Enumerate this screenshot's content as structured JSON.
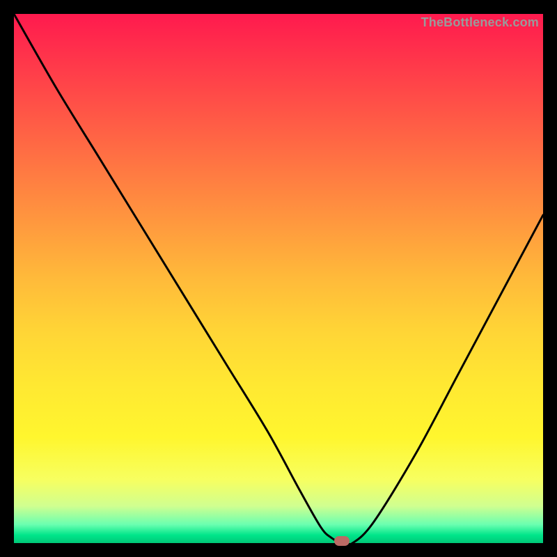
{
  "watermark": "TheBottleneck.com",
  "colors": {
    "curve": "#000000",
    "marker": "#bb6a65",
    "frame": "#000000"
  },
  "chart_data": {
    "type": "line",
    "title": "",
    "xlabel": "",
    "ylabel": "",
    "xlim": [
      0,
      100
    ],
    "ylim": [
      0,
      100
    ],
    "grid": false,
    "legend": false,
    "x": [
      0,
      8,
      16,
      24,
      32,
      40,
      48,
      54,
      58,
      60,
      62,
      64,
      68,
      76,
      84,
      92,
      100
    ],
    "values": [
      100,
      86,
      73,
      60,
      47,
      34,
      21,
      10,
      3,
      1,
      0,
      0,
      4,
      17,
      32,
      47,
      62
    ],
    "marker": {
      "x": 62,
      "y": 0
    },
    "note": "Values are estimated from the plotted curve; no numeric axes are visible."
  }
}
